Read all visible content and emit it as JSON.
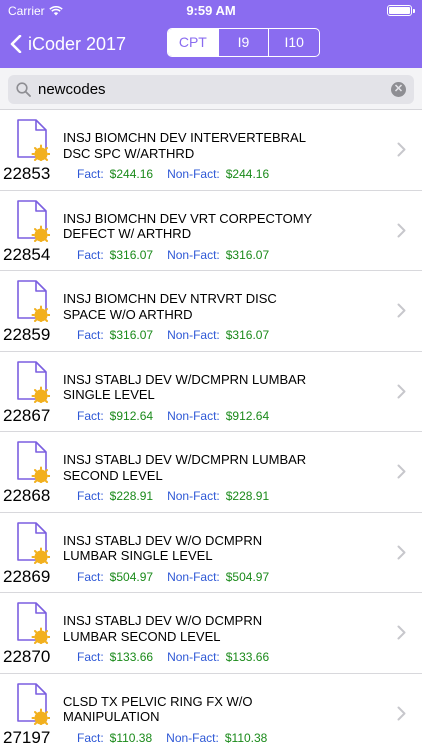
{
  "status_bar": {
    "carrier": "Carrier",
    "time": "9:59 AM",
    "battery_level": 1.0
  },
  "nav": {
    "back_label": "iCoder 2017",
    "segments": [
      "CPT",
      "I9",
      "I10"
    ],
    "selected_segment": "CPT",
    "accent_color": "#8a6cf0"
  },
  "search": {
    "query": "newcodes",
    "placeholder": ""
  },
  "results": [
    {
      "code": "22853",
      "desc": "INSJ BIOMCHN DEV INTERVERTEBRAL DSC SPC W/ARTHRD",
      "fact_label": "Fact:",
      "fact": "$244.16",
      "nonfact_label": "Non-Fact:",
      "nonfact": "$244.16"
    },
    {
      "code": "22854",
      "desc": "INSJ BIOMCHN DEV VRT CORPECTOMY DEFECT W/ ARTHRD",
      "fact_label": "Fact:",
      "fact": "$316.07",
      "nonfact_label": "Non-Fact:",
      "nonfact": "$316.07"
    },
    {
      "code": "22859",
      "desc": "INSJ BIOMCHN DEV NTRVRT DISC SPACE W/O ARTHRD",
      "fact_label": "Fact:",
      "fact": "$316.07",
      "nonfact_label": "Non-Fact:",
      "nonfact": "$316.07"
    },
    {
      "code": "22867",
      "desc": "INSJ STABLJ DEV W/DCMPRN LUMBAR SINGLE LEVEL",
      "fact_label": "Fact:",
      "fact": "$912.64",
      "nonfact_label": "Non-Fact:",
      "nonfact": "$912.64"
    },
    {
      "code": "22868",
      "desc": "INSJ STABLJ DEV W/DCMPRN LUMBAR SECOND LEVEL",
      "fact_label": "Fact:",
      "fact": "$228.91",
      "nonfact_label": "Non-Fact:",
      "nonfact": "$228.91"
    },
    {
      "code": "22869",
      "desc": "INSJ STABLJ DEV W/O DCMPRN LUMBAR SINGLE LEVEL",
      "fact_label": "Fact:",
      "fact": "$504.97",
      "nonfact_label": "Non-Fact:",
      "nonfact": "$504.97"
    },
    {
      "code": "22870",
      "desc": "INSJ STABLJ DEV W/O DCMPRN LUMBAR SECOND LEVEL",
      "fact_label": "Fact:",
      "fact": "$133.66",
      "nonfact_label": "Non-Fact:",
      "nonfact": "$133.66"
    },
    {
      "code": "27197",
      "desc": "CLSD TX PELVIC RING FX W/O MANIPULATION",
      "fact_label": "Fact:",
      "fact": "$110.38",
      "nonfact_label": "Non-Fact:",
      "nonfact": "$110.38"
    }
  ],
  "icons": {
    "back": "chevron-left-icon",
    "search": "search-icon",
    "clear": "clear-icon",
    "row_document": "new-document-icon",
    "row_disclosure": "chevron-right-icon"
  }
}
